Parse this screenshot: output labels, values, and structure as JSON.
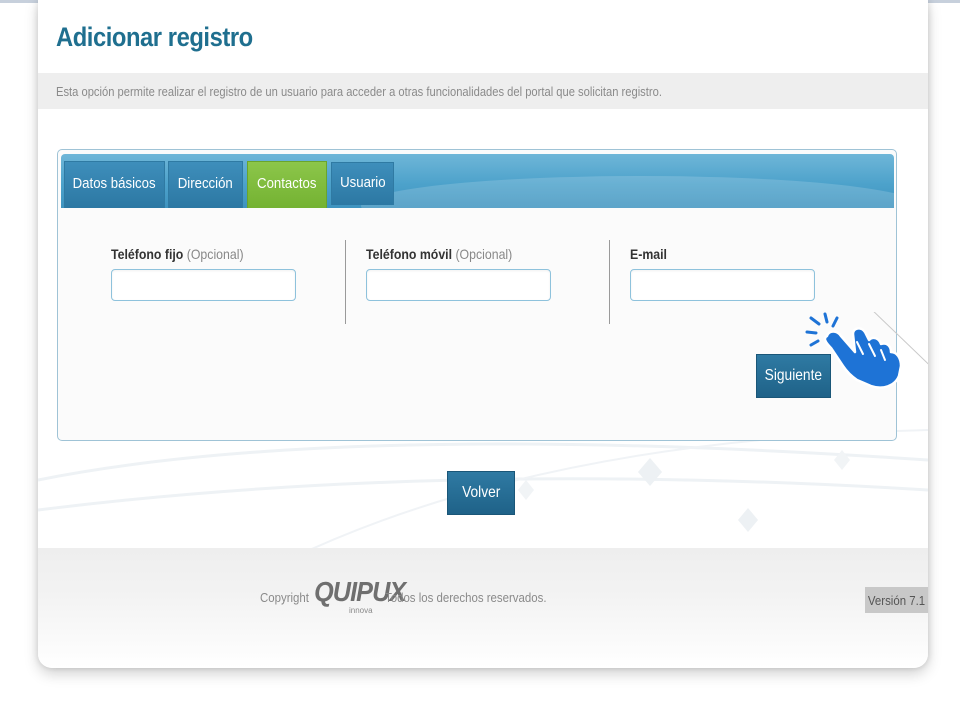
{
  "page": {
    "title": "Adicionar registro",
    "description": "Esta opción permite realizar el registro de un usuario para acceder a otras funcionalidades del portal que solicitan registro."
  },
  "tabs": [
    {
      "label": "Datos básicos",
      "active": false
    },
    {
      "label": "Dirección",
      "active": false
    },
    {
      "label": "Contactos",
      "active": true
    },
    {
      "label": "Usuario",
      "active": false
    }
  ],
  "fields": {
    "telefono_fijo": {
      "label": "Teléfono fijo",
      "optional": "(Opcional)",
      "value": ""
    },
    "telefono_movil": {
      "label": "Teléfono móvil",
      "optional": "(Opcional)",
      "value": ""
    },
    "email": {
      "label": "E-mail",
      "value": ""
    }
  },
  "buttons": {
    "siguiente": "Siguiente",
    "volver": "Volver"
  },
  "footer": {
    "copyright": "Copyright",
    "logo": "QUIPUX",
    "logo_sub": "innova",
    "rights": "Todos los derechos reservados.",
    "version": "Versión 7.1"
  },
  "colors": {
    "title": "#1f6f8f",
    "tab_active": "#8cc64a",
    "tab_inactive": "#2c78a3",
    "button": "#1f6288",
    "hand_icon": "#1e73d6"
  },
  "icons": {
    "hand": "pointing-hand-click-icon"
  }
}
